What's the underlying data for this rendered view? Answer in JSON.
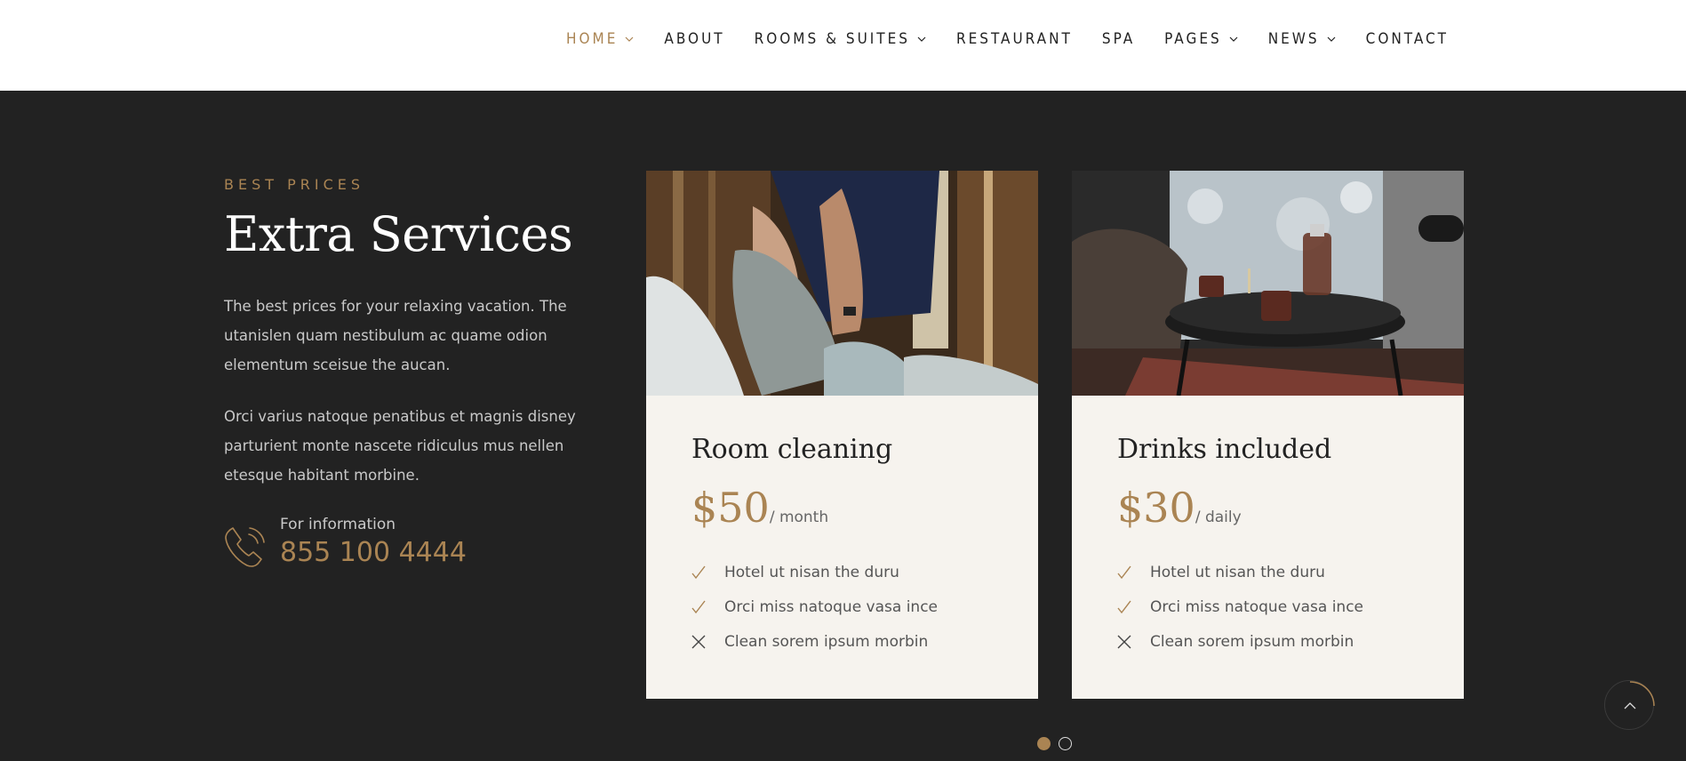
{
  "nav": {
    "items": [
      {
        "label": "HOME",
        "dropdown": true,
        "active": true
      },
      {
        "label": "ABOUT",
        "dropdown": false
      },
      {
        "label": "ROOMS & SUITES",
        "dropdown": true
      },
      {
        "label": "RESTAURANT",
        "dropdown": false
      },
      {
        "label": "SPA",
        "dropdown": false
      },
      {
        "label": "PAGES",
        "dropdown": true
      },
      {
        "label": "NEWS",
        "dropdown": true
      },
      {
        "label": "CONTACT",
        "dropdown": false
      }
    ]
  },
  "section": {
    "subtitle": "BEST PRICES",
    "title": "Extra Services",
    "paragraph1": "The best prices for your relaxing vacation. The utanislen quam nestibulum ac quame odion elementum sceisue the aucan.",
    "paragraph2": "Orci varius natoque penatibus et magnis disney parturient monte nascete ridiculus mus nellen etesque habitant morbine.",
    "info_label": "For information",
    "phone": "855 100 4444",
    "icon": "phone-icon"
  },
  "cards": [
    {
      "title": "Room cleaning",
      "price": "$50",
      "period": "/ month",
      "image": "housekeeping-photo",
      "features": [
        {
          "text": "Hotel ut nisan the duru",
          "included": true
        },
        {
          "text": "Orci miss natoque vasa ince",
          "included": true
        },
        {
          "text": "Clean sorem ipsum morbin",
          "included": false
        }
      ]
    },
    {
      "title": "Drinks included",
      "price": "$30",
      "period": "/ daily",
      "image": "drinks-table-photo",
      "features": [
        {
          "text": "Hotel ut nisan the duru",
          "included": true
        },
        {
          "text": "Orci miss natoque vasa ince",
          "included": true
        },
        {
          "text": "Clean sorem ipsum morbin",
          "included": false
        }
      ]
    }
  ],
  "pager": {
    "count": 2,
    "active_index": 0
  },
  "colors": {
    "accent": "#aa8453",
    "background": "#222222",
    "card": "#f6f3ee",
    "header": "#ffffff"
  }
}
